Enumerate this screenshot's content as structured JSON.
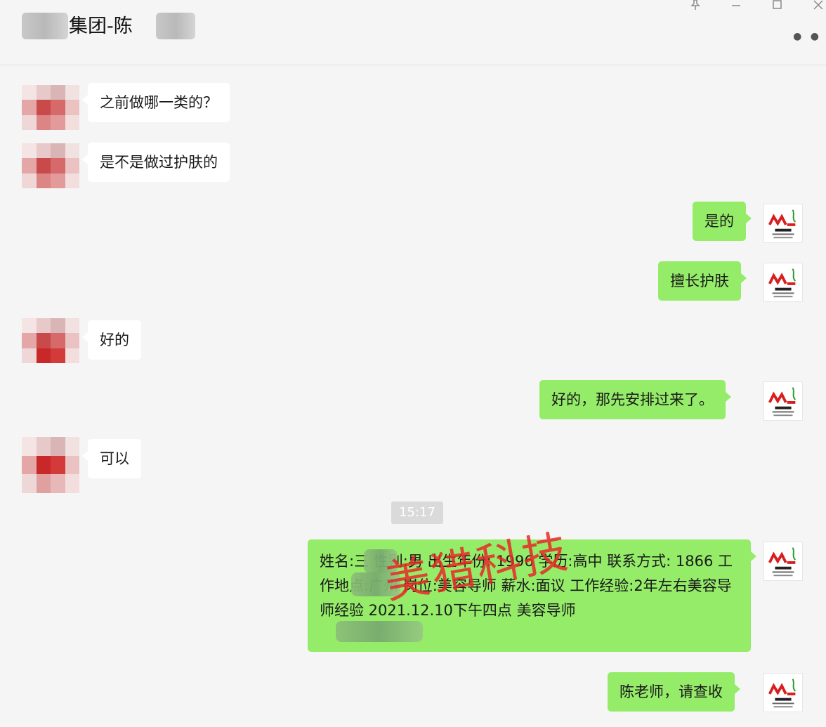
{
  "header": {
    "title": "集团-陈",
    "controls": {
      "pin_icon": "pin-icon",
      "minimize_icon": "minimize-icon",
      "maximize_icon": "maximize-icon",
      "close_icon": "close-icon",
      "more_icon": "more-icon"
    }
  },
  "messages": [
    {
      "side": "left",
      "text": "之前做哪一类的？"
    },
    {
      "side": "left",
      "text": "是不是做过护肤的"
    },
    {
      "side": "right",
      "text": "是的"
    },
    {
      "side": "right",
      "text": "擅长护肤"
    },
    {
      "side": "left",
      "text": "好的"
    },
    {
      "side": "right",
      "text": "好的，那先安排过来了。"
    },
    {
      "side": "left",
      "text": "可以"
    },
    {
      "side": "right",
      "text": "姓名:三 性别:男 出生年份: 1996 学历:高中 联系方式: 1866 工作地点:广州 岗位:美容导师 薪水:面议 工作经验:2年左右美容导师经验 2021.12.10下午四点 美容导师"
    },
    {
      "side": "right",
      "text": "陈老师，请查收"
    }
  ],
  "timestamp": "15:17",
  "watermark": "美猎科技",
  "colors": {
    "background": "#f5f5f5",
    "outgoing_bubble": "#95ec69",
    "incoming_bubble": "#ffffff",
    "watermark": "#e82828"
  }
}
